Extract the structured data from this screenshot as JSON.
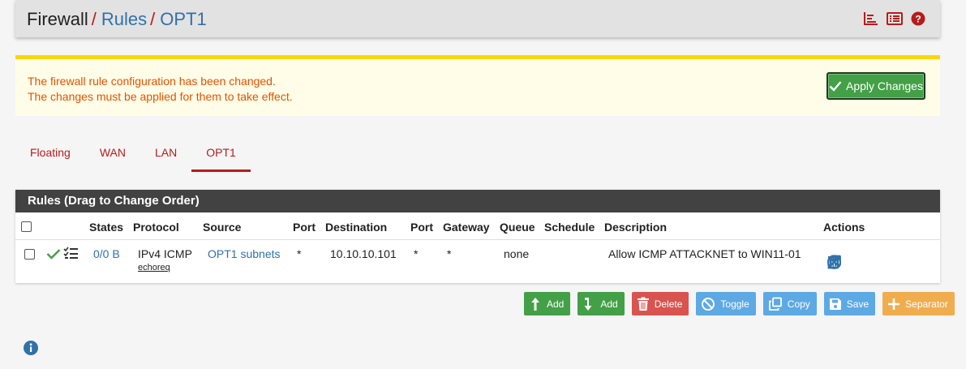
{
  "breadcrumb": {
    "items": [
      "Firewall",
      "Rules",
      "OPT1"
    ]
  },
  "alert": {
    "line1": "The firewall rule configuration has been changed.",
    "line2": "The changes must be applied for them to take effect.",
    "apply_label": "Apply Changes"
  },
  "tabs": [
    {
      "label": "Floating"
    },
    {
      "label": "WAN"
    },
    {
      "label": "LAN"
    },
    {
      "label": "OPT1",
      "active": true
    }
  ],
  "panel": {
    "title": "Rules (Drag to Change Order)",
    "columns": [
      "States",
      "Protocol",
      "Source",
      "Port",
      "Destination",
      "Port",
      "Gateway",
      "Queue",
      "Schedule",
      "Description",
      "Actions"
    ],
    "rows": [
      {
        "states": "0/0 B",
        "protocol": "IPv4 ICMP",
        "protocol_sub": "echoreq",
        "source": "OPT1 subnets",
        "src_port": "*",
        "destination": "10.10.10.101",
        "dst_port": "*",
        "gateway": "*",
        "queue": "none",
        "schedule": "",
        "description": "Allow ICMP ATTACKNET to WIN11-01"
      }
    ]
  },
  "buttons": {
    "add_top": "Add",
    "add_bottom": "Add",
    "delete": "Delete",
    "toggle": "Toggle",
    "copy": "Copy",
    "save": "Save",
    "separator": "Separator"
  },
  "colors": {
    "accent_red": "#b71c1c",
    "link_blue": "#3071a9",
    "success_green": "#43a047",
    "alert_yellow": "#ffd600",
    "alert_text": "#e65100"
  },
  "icons": [
    "chart-icon",
    "list-icon",
    "help-icon",
    "check-icon",
    "tasks-icon",
    "anchor-icon",
    "pencil-icon",
    "clone-icon",
    "ban-icon",
    "trash-icon",
    "times-icon",
    "info-icon"
  ]
}
